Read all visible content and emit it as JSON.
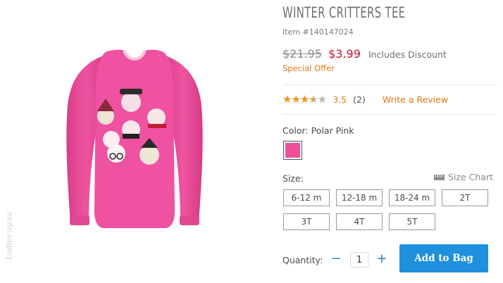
{
  "product": {
    "title": "WINTER CRITTERS TEE",
    "item_number": "Item #140147024"
  },
  "price": {
    "original": "$21.95",
    "sale": "$3.99",
    "discount_note": "Includes Discount",
    "special_offer": "Special Offer"
  },
  "rating": {
    "stars_value": 3.5,
    "stars_max": 5,
    "value_text": "3.5",
    "review_count": "(2)",
    "write_review": "Write a Review"
  },
  "color": {
    "label": "Color: Polar Pink",
    "swatch_hex": "#f0509a"
  },
  "size": {
    "label": "Size:",
    "chart_link": "Size Chart",
    "options": [
      "6-12 m",
      "12-18 m",
      "18-24 m",
      "2T",
      "3T",
      "4T",
      "5T"
    ]
  },
  "quantity": {
    "label": "Quantity:",
    "minus": "−",
    "value": "1",
    "plus": "+"
  },
  "cart": {
    "add_to_bag": "Add to Bag"
  },
  "watermark": "Ladies ay.ua",
  "colors": {
    "sale_red": "#c8102e",
    "accent_orange": "#e07a14",
    "button_blue": "#1e90dc",
    "shirt_pink": "#ec4a94"
  }
}
